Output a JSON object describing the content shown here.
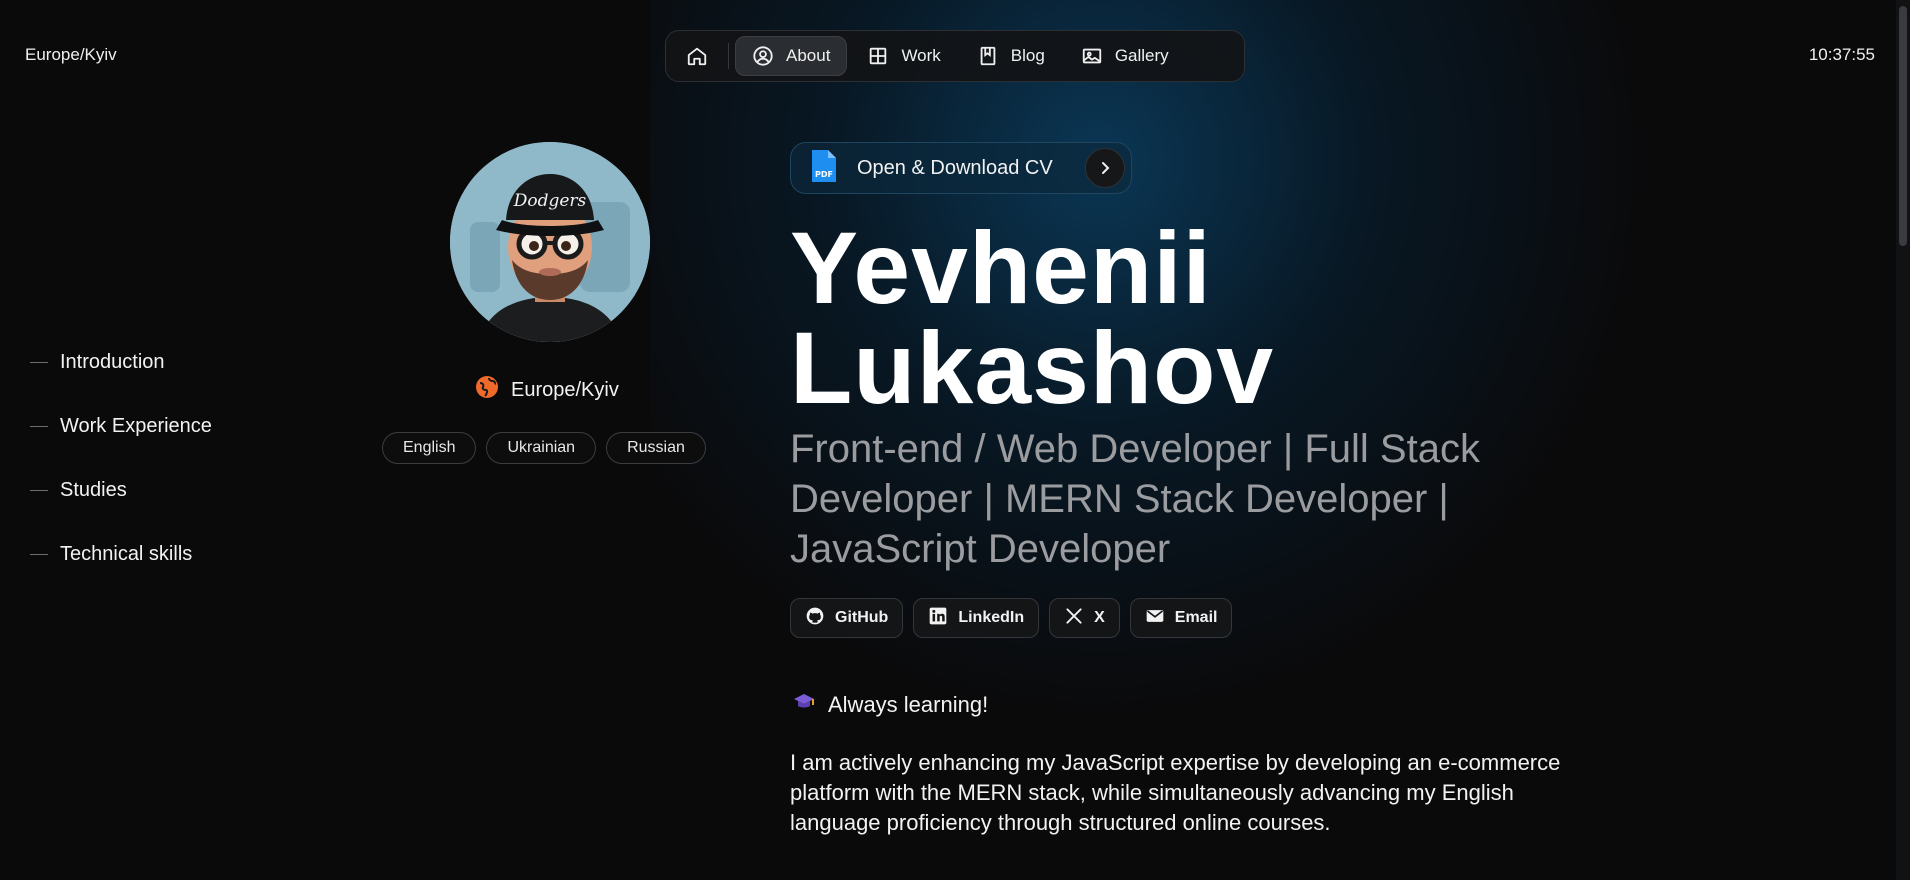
{
  "header": {
    "timezone": "Europe/Kyiv",
    "clock": "10:37:55"
  },
  "nav": {
    "items": [
      {
        "label": "About",
        "icon": "user-circle-icon",
        "active": true
      },
      {
        "label": "Work",
        "icon": "grid-icon"
      },
      {
        "label": "Blog",
        "icon": "book-icon"
      },
      {
        "label": "Gallery",
        "icon": "image-icon"
      }
    ]
  },
  "sidebar": {
    "items": [
      {
        "label": "Introduction"
      },
      {
        "label": "Work Experience"
      },
      {
        "label": "Studies"
      },
      {
        "label": "Technical skills"
      }
    ]
  },
  "profile": {
    "location": "Europe/Kyiv",
    "languages": [
      "English",
      "Ukrainian",
      "Russian"
    ],
    "avatar_cap_text": "Dodgers"
  },
  "cv": {
    "label": "Open & Download CV",
    "icon_text": "PDF"
  },
  "intro": {
    "first_name": "Yevhenii",
    "last_name": "Lukashov",
    "headline": "Front-end / Web Developer | Full Stack Developer | MERN Stack Developer | JavaScript Developer",
    "socials": [
      {
        "label": "GitHub",
        "icon": "github-icon"
      },
      {
        "label": "LinkedIn",
        "icon": "linkedin-icon"
      },
      {
        "label": "X",
        "icon": "x-icon"
      },
      {
        "label": "Email",
        "icon": "email-icon"
      }
    ],
    "badge": "Always learning!",
    "about": "I am actively enhancing my JavaScript expertise by developing an e-commerce platform with the MERN stack, while simultaneously advancing my English language proficiency through structured online courses."
  },
  "colors": {
    "background": "#0a0a0b",
    "accent_glow": "#0a466e",
    "muted_text": "#9a9ca0"
  }
}
